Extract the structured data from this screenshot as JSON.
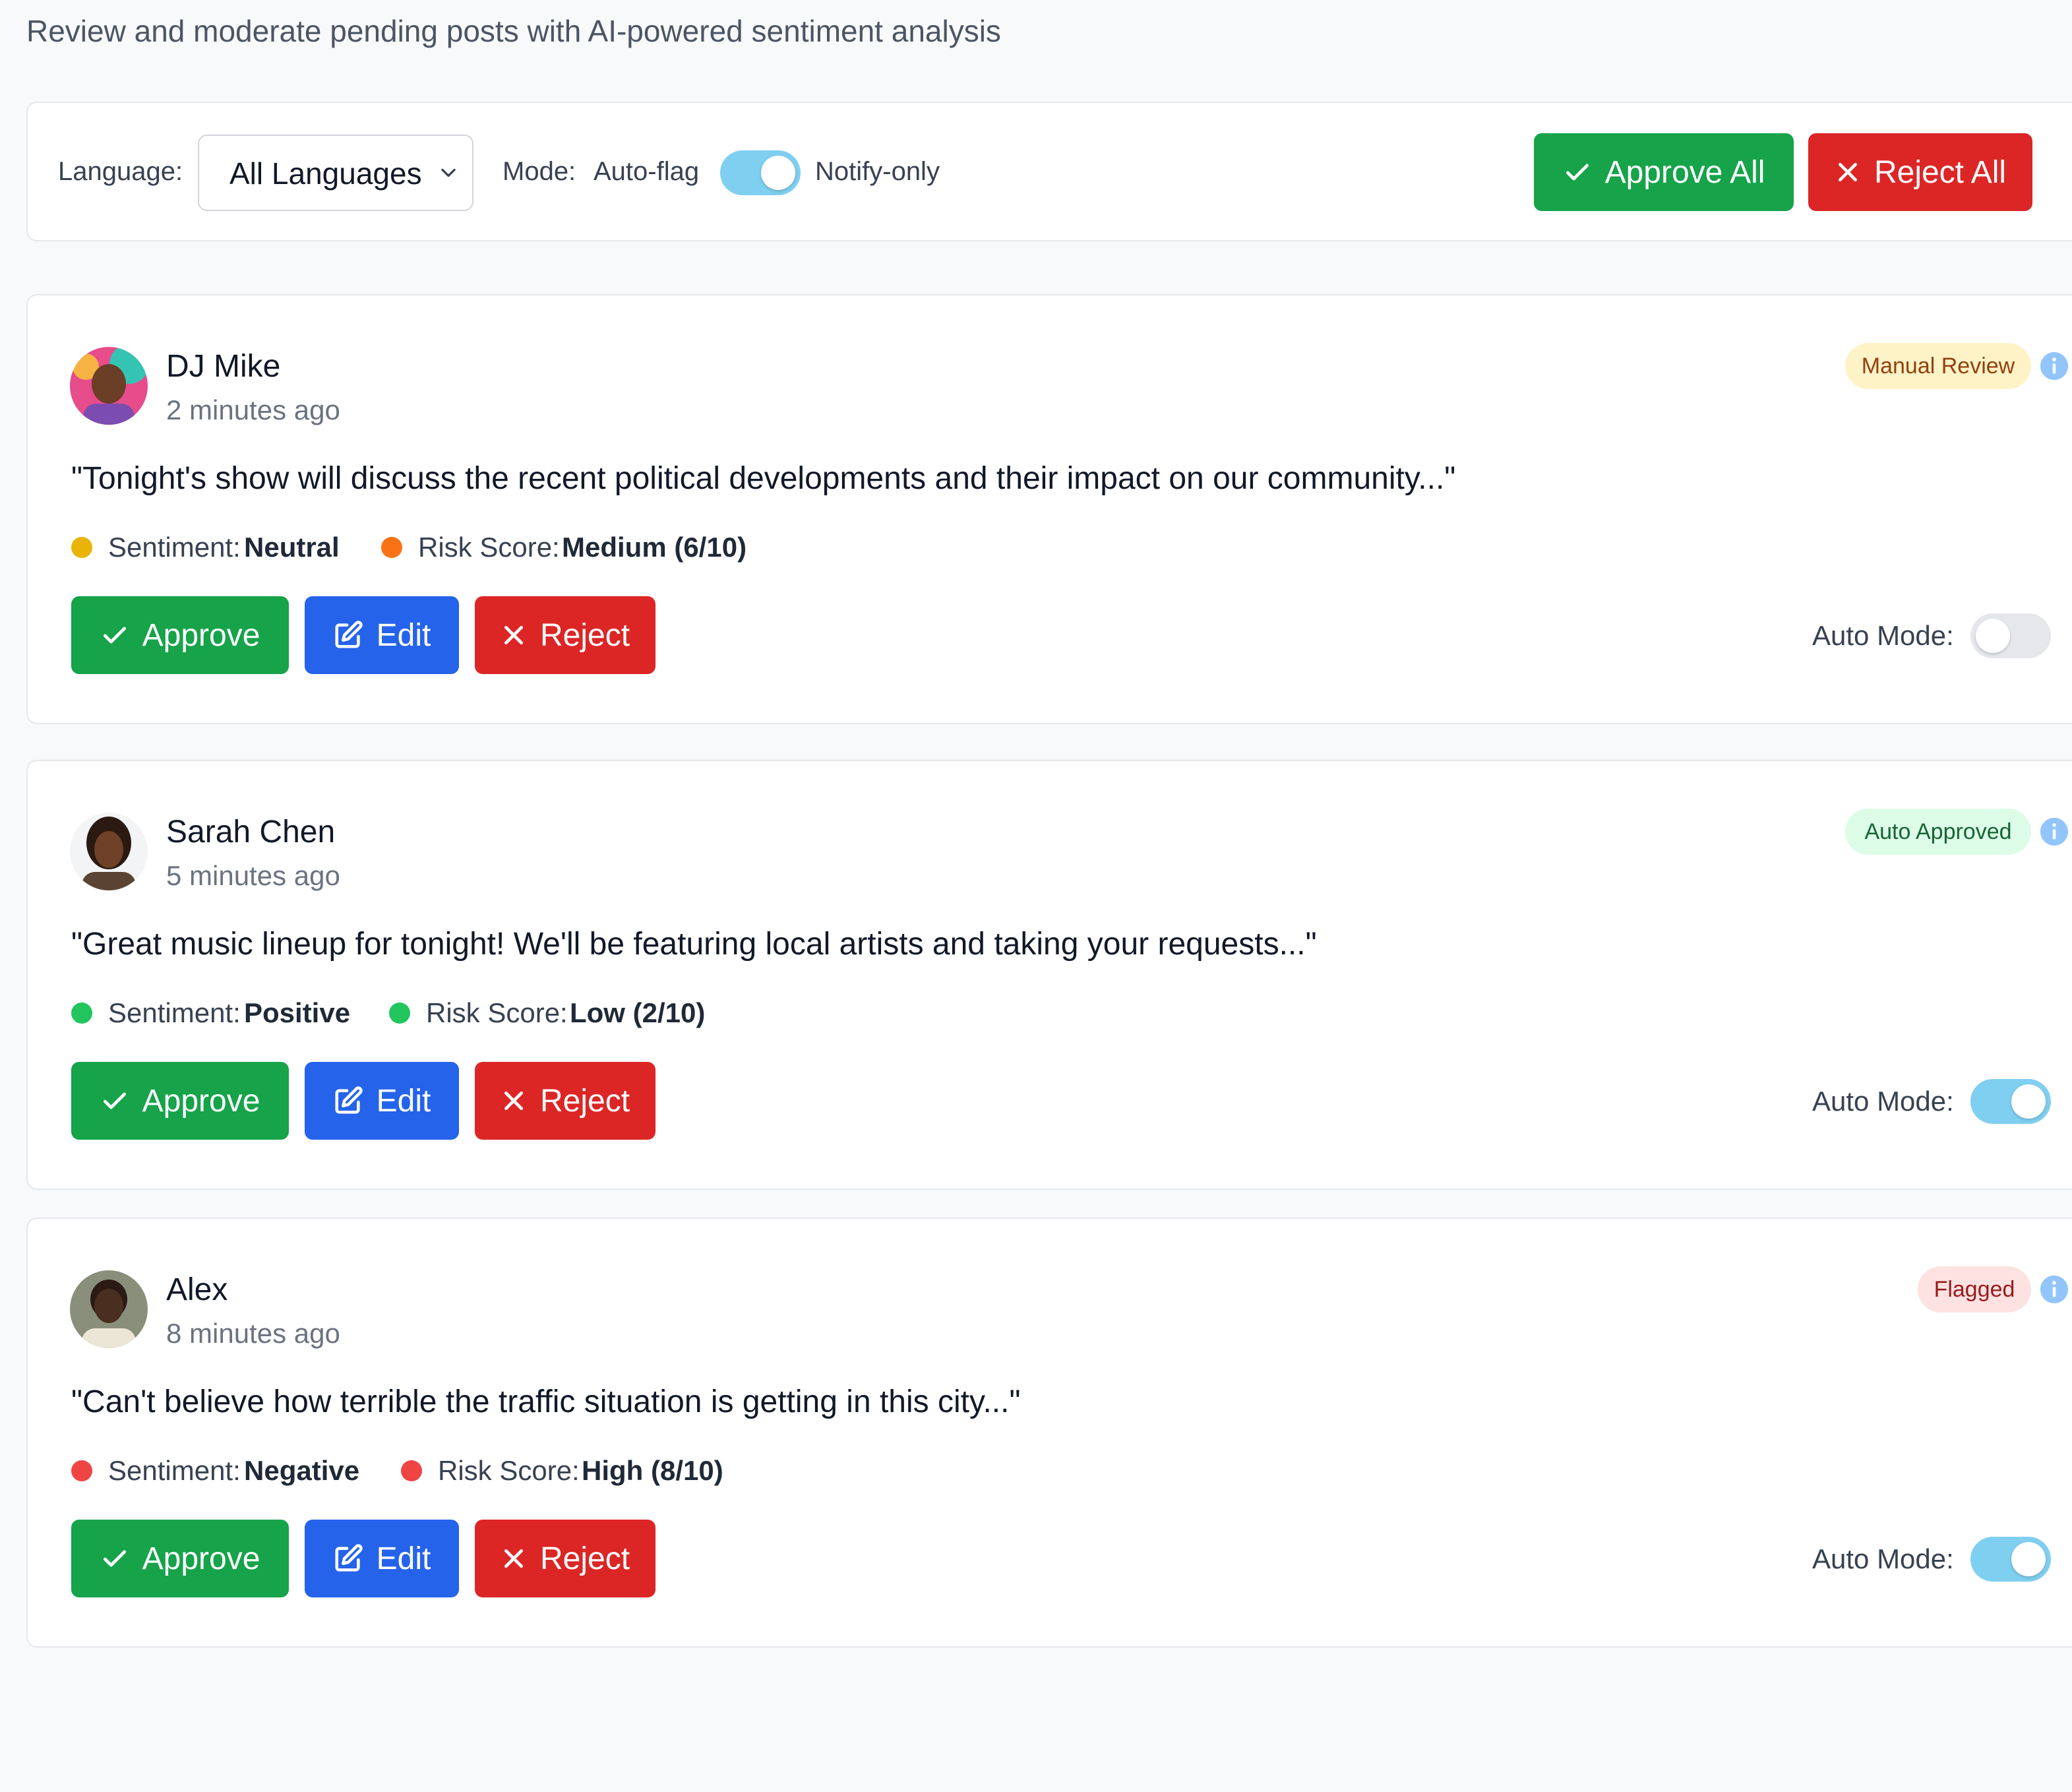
{
  "subtitle": "Review and moderate pending posts with AI-powered sentiment analysis",
  "toolbar": {
    "language_label": "Language:",
    "language_value": "All Languages",
    "mode_label": "Mode:",
    "mode_left": "Auto-flag",
    "mode_right": "Notify-only",
    "mode_toggle_on": true,
    "approve_all": "Approve All",
    "reject_all": "Reject All"
  },
  "colors": {
    "approve": "#16a34a",
    "edit": "#2563eb",
    "reject": "#dc2626",
    "toggle_on": "#7fcff0",
    "toggle_off": "#e5e7eb",
    "neutral_dot": "#eab308",
    "medium_dot": "#f97316",
    "positive_dot": "#22c55e",
    "negative_dot": "#ef4444"
  },
  "posts": [
    {
      "author": "DJ Mike",
      "time": "2 minutes ago",
      "status": "Manual Review",
      "status_style": "yellow",
      "text": "\"Tonight's show will discuss the recent political developments and their impact on our community...\"",
      "sentiment_label": "Sentiment:",
      "sentiment": "Neutral",
      "sentiment_color": "#eab308",
      "risk_label": "Risk Score:",
      "risk": "Medium (6/10)",
      "risk_color": "#f97316",
      "approve": "Approve",
      "edit": "Edit",
      "reject": "Reject",
      "auto_mode_label": "Auto Mode:",
      "auto_mode_on": false
    },
    {
      "author": "Sarah Chen",
      "time": "5 minutes ago",
      "status": "Auto Approved",
      "status_style": "green",
      "text": "\"Great music lineup for tonight! We'll be featuring local artists and taking your requests...\"",
      "sentiment_label": "Sentiment:",
      "sentiment": "Positive",
      "sentiment_color": "#22c55e",
      "risk_label": "Risk Score:",
      "risk": "Low (2/10)",
      "risk_color": "#22c55e",
      "approve": "Approve",
      "edit": "Edit",
      "reject": "Reject",
      "auto_mode_label": "Auto Mode:",
      "auto_mode_on": true
    },
    {
      "author": "Alex",
      "time": "8 minutes ago",
      "status": "Flagged",
      "status_style": "red",
      "text": "\"Can't believe how terrible the traffic situation is getting in this city...\"",
      "sentiment_label": "Sentiment:",
      "sentiment": "Negative",
      "sentiment_color": "#ef4444",
      "risk_label": "Risk Score:",
      "risk": "High (8/10)",
      "risk_color": "#ef4444",
      "approve": "Approve",
      "edit": "Edit",
      "reject": "Reject",
      "auto_mode_label": "Auto Mode:",
      "auto_mode_on": true
    }
  ]
}
